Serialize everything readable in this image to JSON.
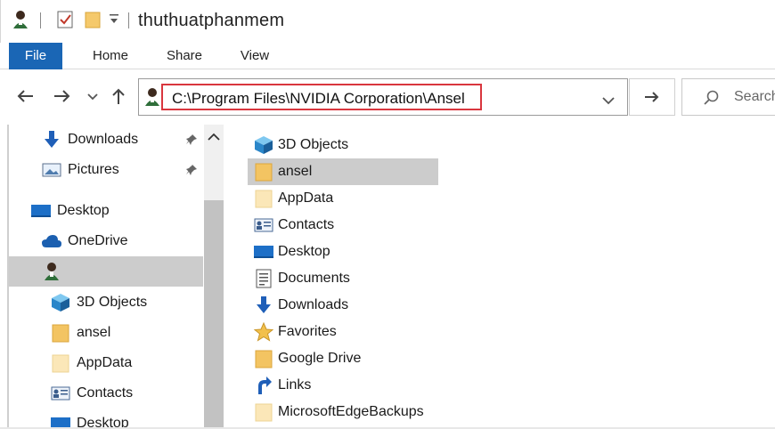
{
  "window": {
    "title": "thuthuatphanmem"
  },
  "ribbon": {
    "tabs": [
      "File",
      "Home",
      "Share",
      "View"
    ]
  },
  "address": {
    "path": "C:\\Program Files\\NVIDIA Corporation\\Ansel"
  },
  "search": {
    "placeholder": "Search"
  },
  "nav": {
    "items": [
      {
        "label": "Downloads",
        "icon": "download-arrow-icon",
        "pinned": true
      },
      {
        "label": "Pictures",
        "icon": "pictures-icon",
        "pinned": true
      },
      {
        "label": "Desktop",
        "icon": "desktop-icon"
      },
      {
        "label": "OneDrive",
        "icon": "cloud-icon"
      },
      {
        "label": "",
        "icon": "user-icon",
        "selected": true
      },
      {
        "label": "3D Objects",
        "icon": "3d-objects-icon"
      },
      {
        "label": "ansel",
        "icon": "folder-icon"
      },
      {
        "label": "AppData",
        "icon": "folder-light-icon"
      },
      {
        "label": "Contacts",
        "icon": "contacts-icon"
      },
      {
        "label": "Desktop",
        "icon": "desktop-icon"
      }
    ]
  },
  "content": {
    "items": [
      {
        "label": "3D Objects",
        "icon": "3d-objects-icon"
      },
      {
        "label": "ansel",
        "icon": "folder-icon",
        "selected": true
      },
      {
        "label": "AppData",
        "icon": "folder-light-icon"
      },
      {
        "label": "Contacts",
        "icon": "contacts-icon"
      },
      {
        "label": "Desktop",
        "icon": "desktop-icon"
      },
      {
        "label": "Documents",
        "icon": "documents-icon"
      },
      {
        "label": "Downloads",
        "icon": "download-arrow-icon"
      },
      {
        "label": "Favorites",
        "icon": "star-icon"
      },
      {
        "label": "Google Drive",
        "icon": "folder-icon"
      },
      {
        "label": "Links",
        "icon": "links-icon"
      },
      {
        "label": "MicrosoftEdgeBackups",
        "icon": "folder-light-icon"
      }
    ]
  },
  "colors": {
    "accent": "#1a66b5",
    "highlight": "#d9363e",
    "selection": "#cccccc"
  }
}
